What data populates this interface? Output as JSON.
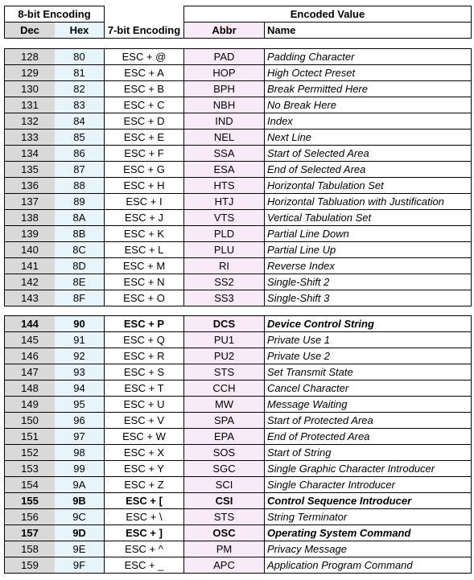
{
  "header": {
    "group_8bit": "8-bit Encoding",
    "group_encoded": "Encoded Value",
    "col_dec": "Dec",
    "col_hex": "Hex",
    "col_7bit": "7-bit Encoding",
    "col_abbr": "Abbr",
    "col_name": "Name"
  },
  "groups": [
    {
      "rows": [
        {
          "dec": "128",
          "hex": "80",
          "esc": "ESC + @",
          "abbr": "PAD",
          "name": "Padding Character",
          "bold": false
        },
        {
          "dec": "129",
          "hex": "81",
          "esc": "ESC + A",
          "abbr": "HOP",
          "name": "High Octect Preset",
          "bold": false
        },
        {
          "dec": "130",
          "hex": "82",
          "esc": "ESC + B",
          "abbr": "BPH",
          "name": "Break Permitted Here",
          "bold": false
        },
        {
          "dec": "131",
          "hex": "83",
          "esc": "ESC + C",
          "abbr": "NBH",
          "name": "No Break Here",
          "bold": false
        },
        {
          "dec": "132",
          "hex": "84",
          "esc": "ESC + D",
          "abbr": "IND",
          "name": "Index",
          "bold": false
        },
        {
          "dec": "133",
          "hex": "85",
          "esc": "ESC + E",
          "abbr": "NEL",
          "name": "Next Line",
          "bold": false
        },
        {
          "dec": "134",
          "hex": "86",
          "esc": "ESC + F",
          "abbr": "SSA",
          "name": "Start of Selected Area",
          "bold": false
        },
        {
          "dec": "135",
          "hex": "87",
          "esc": "ESC + G",
          "abbr": "ESA",
          "name": "End of Selected Area",
          "bold": false
        },
        {
          "dec": "136",
          "hex": "88",
          "esc": "ESC + H",
          "abbr": "HTS",
          "name": "Horizontal Tabulation Set",
          "bold": false
        },
        {
          "dec": "137",
          "hex": "89",
          "esc": "ESC + I",
          "abbr": "HTJ",
          "name": "Horizontal Tabluation with Justification",
          "bold": false
        },
        {
          "dec": "138",
          "hex": "8A",
          "esc": "ESC + J",
          "abbr": "VTS",
          "name": "Vertical Tabulation Set",
          "bold": false
        },
        {
          "dec": "139",
          "hex": "8B",
          "esc": "ESC + K",
          "abbr": "PLD",
          "name": "Partial Line Down",
          "bold": false
        },
        {
          "dec": "140",
          "hex": "8C",
          "esc": "ESC + L",
          "abbr": "PLU",
          "name": "Partial Line Up",
          "bold": false
        },
        {
          "dec": "141",
          "hex": "8D",
          "esc": "ESC + M",
          "abbr": "RI",
          "name": "Reverse Index",
          "bold": false
        },
        {
          "dec": "142",
          "hex": "8E",
          "esc": "ESC + N",
          "abbr": "SS2",
          "name": "Single-Shift 2",
          "bold": false
        },
        {
          "dec": "143",
          "hex": "8F",
          "esc": "ESC + O",
          "abbr": "SS3",
          "name": "Single-Shift 3",
          "bold": false
        }
      ]
    },
    {
      "rows": [
        {
          "dec": "144",
          "hex": "90",
          "esc": "ESC + P",
          "abbr": "DCS",
          "name": "Device Control String",
          "bold": true
        },
        {
          "dec": "145",
          "hex": "91",
          "esc": "ESC + Q",
          "abbr": "PU1",
          "name": "Private Use 1",
          "bold": false
        },
        {
          "dec": "146",
          "hex": "92",
          "esc": "ESC + R",
          "abbr": "PU2",
          "name": "Private Use 2",
          "bold": false
        },
        {
          "dec": "147",
          "hex": "93",
          "esc": "ESC + S",
          "abbr": "STS",
          "name": "Set Transmit State",
          "bold": false
        },
        {
          "dec": "148",
          "hex": "94",
          "esc": "ESC + T",
          "abbr": "CCH",
          "name": "Cancel Character",
          "bold": false
        },
        {
          "dec": "149",
          "hex": "95",
          "esc": "ESC + U",
          "abbr": "MW",
          "name": "Message Waiting",
          "bold": false
        },
        {
          "dec": "150",
          "hex": "96",
          "esc": "ESC + V",
          "abbr": "SPA",
          "name": "Start of Protected Area",
          "bold": false
        },
        {
          "dec": "151",
          "hex": "97",
          "esc": "ESC + W",
          "abbr": "EPA",
          "name": "End of Protected Area",
          "bold": false
        },
        {
          "dec": "152",
          "hex": "98",
          "esc": "ESC + X",
          "abbr": "SOS",
          "name": "Start of String",
          "bold": false
        },
        {
          "dec": "153",
          "hex": "99",
          "esc": "ESC + Y",
          "abbr": "SGC",
          "name": "Single Graphic Character Introducer",
          "bold": false
        },
        {
          "dec": "154",
          "hex": "9A",
          "esc": "ESC + Z",
          "abbr": "SCI",
          "name": "Single Character Introducer",
          "bold": false
        },
        {
          "dec": "155",
          "hex": "9B",
          "esc": "ESC + [",
          "abbr": "CSI",
          "name": "Control Sequence Introducer",
          "bold": true
        },
        {
          "dec": "156",
          "hex": "9C",
          "esc": "ESC + \\",
          "abbr": "STS",
          "name": "String Terminator",
          "bold": false
        },
        {
          "dec": "157",
          "hex": "9D",
          "esc": "ESC + ]",
          "abbr": "OSC",
          "name": "Operating System Command",
          "bold": true
        },
        {
          "dec": "158",
          "hex": "9E",
          "esc": "ESC + ^",
          "abbr": "PM",
          "name": "Privacy Message",
          "bold": false
        },
        {
          "dec": "159",
          "hex": "9F",
          "esc": "ESC + _",
          "abbr": "APC",
          "name": "Application Program Command",
          "bold": false
        }
      ]
    }
  ]
}
